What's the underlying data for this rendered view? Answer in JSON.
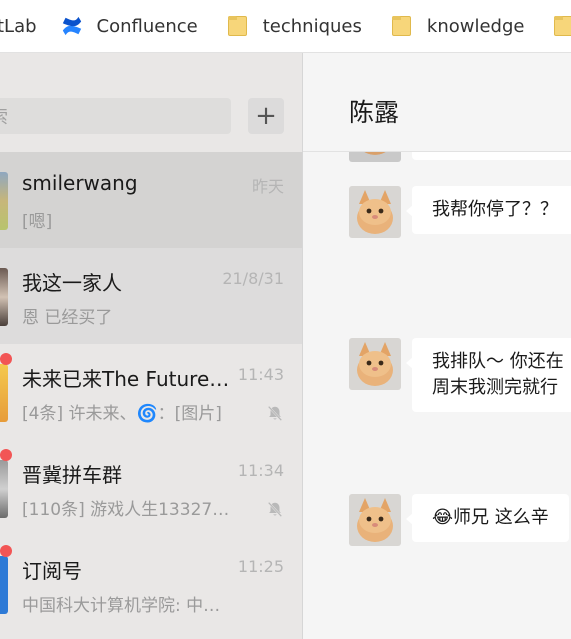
{
  "bookmarks": [
    {
      "label": "itLab",
      "icon": "gitlab-icon"
    },
    {
      "label": "Confluence",
      "icon": "confluence-icon"
    },
    {
      "label": "techniques",
      "icon": "folder-icon"
    },
    {
      "label": "knowledge",
      "icon": "folder-icon"
    }
  ],
  "search": {
    "placeholder": "索"
  },
  "add_button": {
    "label": "+"
  },
  "chats": [
    {
      "title": "smilerwang",
      "time": "昨天",
      "preview": "[嗯]",
      "muted": false,
      "unread": false
    },
    {
      "title": "我这一家人",
      "time": "21/8/31",
      "preview": "恩  已经买了",
      "muted": false,
      "unread": false
    },
    {
      "title": "未来已来The Future…",
      "time": "11:43",
      "preview": "[4条] 许未来、🌀：[图片]",
      "muted": true,
      "unread": true
    },
    {
      "title": "晋冀拼车群",
      "time": "11:34",
      "preview": "[110条] 游戏人生13327…",
      "muted": true,
      "unread": true
    },
    {
      "title": "订阅号",
      "time": "11:25",
      "preview": "中国科大计算机学院: 中…",
      "muted": false,
      "unread": true
    }
  ],
  "conversation": {
    "title": "陈露",
    "messages": [
      {
        "lines": [
          "我帮你停了？？"
        ]
      },
      {
        "lines": [
          "我排队～ 你还在",
          "周末我测完就行"
        ]
      },
      {
        "lines": [
          "😂师兄 这么辛"
        ]
      }
    ]
  },
  "colors": {
    "unread_dot": "#f25555",
    "sidebar_bg": "#e9e7e6",
    "active_item": "#d4d3d2"
  }
}
